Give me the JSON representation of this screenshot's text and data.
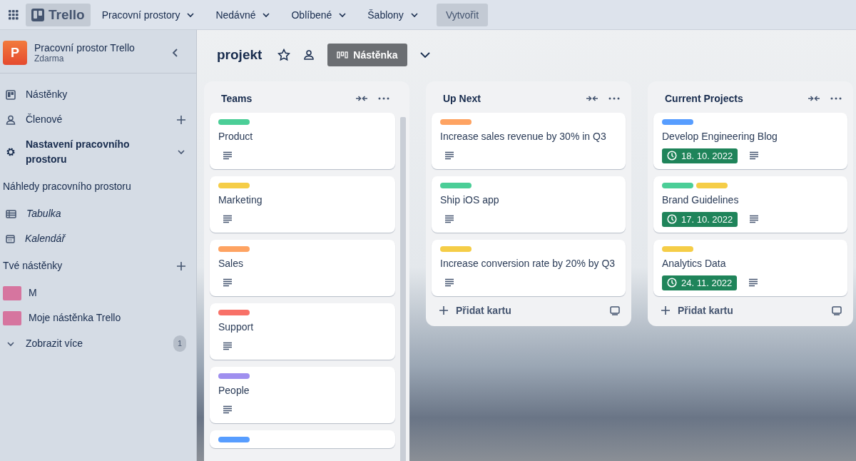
{
  "topbar": {
    "logo": "Trello",
    "menus": [
      {
        "label": "Pracovní prostory"
      },
      {
        "label": "Nedávné"
      },
      {
        "label": "Oblíbené"
      },
      {
        "label": "Šablony"
      }
    ],
    "create_button": "Vytvořit"
  },
  "sidebar": {
    "workspace": {
      "initial": "P",
      "name": "Pracovní prostor Trello",
      "plan": "Zdarma"
    },
    "items": [
      {
        "kind": "nav",
        "label": "Nástěnky"
      },
      {
        "kind": "nav",
        "label": "Členové",
        "addable": true
      },
      {
        "kind": "nav",
        "label": "Nastavení pracovního prostoru",
        "expandable": true,
        "bold": true
      },
      {
        "kind": "heading",
        "label": "Náhledy pracovního prostoru"
      },
      {
        "kind": "view",
        "label": "Tabulka"
      },
      {
        "kind": "view",
        "label": "Kalendář"
      },
      {
        "kind": "heading",
        "label": "Tvé nástěnky",
        "addable": true
      },
      {
        "kind": "board",
        "label": "M",
        "color": "#d6759f"
      },
      {
        "kind": "board",
        "label": "Moje nástěnka Trello",
        "color": "#d6759f"
      },
      {
        "kind": "more",
        "label": "Zobrazit více",
        "count": "1"
      }
    ]
  },
  "board": {
    "title": "projekt",
    "starred": false,
    "view_button": "Nástěnka"
  },
  "lists": [
    {
      "title": "Teams",
      "scrollbar": true,
      "cards": [
        {
          "labels": [
            {
              "color": "#4bce97"
            }
          ],
          "title": "Product",
          "description": true
        },
        {
          "labels": [
            {
              "color": "#f5cd47"
            }
          ],
          "title": "Marketing",
          "description": true
        },
        {
          "labels": [
            {
              "color": "#fea362"
            }
          ],
          "title": "Sales",
          "description": true
        },
        {
          "labels": [
            {
              "color": "#f87168"
            }
          ],
          "title": "Support",
          "description": true
        },
        {
          "labels": [
            {
              "color": "#9f8fef"
            }
          ],
          "title": "People",
          "description": true
        },
        {
          "labels": [
            {
              "color": "#579dff"
            }
          ]
        }
      ]
    },
    {
      "title": "Up Next",
      "add_card": "Přidat kartu",
      "cards": [
        {
          "labels": [
            {
              "color": "#fea362"
            }
          ],
          "title": "Increase sales revenue by 30% in Q3",
          "description": true
        },
        {
          "labels": [
            {
              "color": "#4bce97"
            }
          ],
          "title": "Ship iOS app",
          "description": true
        },
        {
          "labels": [
            {
              "color": "#f5cd47"
            }
          ],
          "title": "Increase conversion rate by 20% by Q3",
          "description": true
        }
      ]
    },
    {
      "title": "Current Projects",
      "add_card": "Přidat kartu",
      "cards": [
        {
          "labels": [
            {
              "color": "#579dff"
            }
          ],
          "title": "Develop Engineering Blog",
          "due": "18. 10. 2022",
          "description": true
        },
        {
          "labels": [
            {
              "color": "#4bce97"
            },
            {
              "color": "#f5cd47"
            }
          ],
          "title": "Brand Guidelines",
          "due": "17. 10. 2022",
          "description": true
        },
        {
          "labels": [
            {
              "color": "#f5cd47"
            }
          ],
          "title": "Analytics Data",
          "due": "24. 11. 2022",
          "description": true
        }
      ]
    }
  ]
}
